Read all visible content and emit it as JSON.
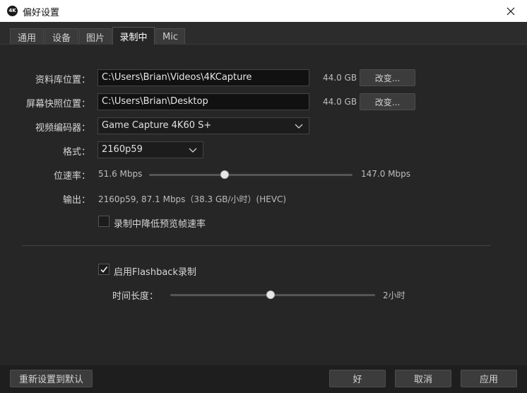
{
  "window": {
    "title": "偏好设置",
    "app_icon_text": "4K",
    "close_icon": "close-icon"
  },
  "tabs": [
    {
      "label": "通用",
      "active": false
    },
    {
      "label": "设备",
      "active": false
    },
    {
      "label": "图片",
      "active": false
    },
    {
      "label": "录制中",
      "active": true
    },
    {
      "label": "Mic",
      "active": false
    }
  ],
  "library": {
    "label": "资料库位置：",
    "path": "C:\\Users\\Brian\\Videos\\4KCapture",
    "free_space": "44.0 GB",
    "change_label": "改变..."
  },
  "screenshot": {
    "label": "屏幕快照位置：",
    "path": "C:\\Users\\Brian\\Desktop",
    "free_space": "44.0 GB",
    "change_label": "改变..."
  },
  "encoder": {
    "label": "视频编码器：",
    "value": "Game Capture 4K60 S+"
  },
  "format": {
    "label": "格式：",
    "value": "2160p59"
  },
  "bitrate": {
    "label": "位速率：",
    "min_label": "51.6 Mbps",
    "max_label": "147.0 Mbps",
    "position_fraction": 0.37
  },
  "output": {
    "label": "输出：",
    "value": "2160p59, 87.1 Mbps（38.3 GB/小时）(HEVC)"
  },
  "reduce_preview": {
    "label": "录制中降低预览帧速率",
    "checked": false
  },
  "flashback": {
    "label": "启用Flashback录制",
    "checked": true
  },
  "duration": {
    "label": "时间长度：",
    "value_label": "2小时",
    "position_fraction": 0.49
  },
  "footer": {
    "reset_label": "重新设置到默认",
    "ok_label": "好",
    "cancel_label": "取消",
    "apply_label": "应用"
  }
}
